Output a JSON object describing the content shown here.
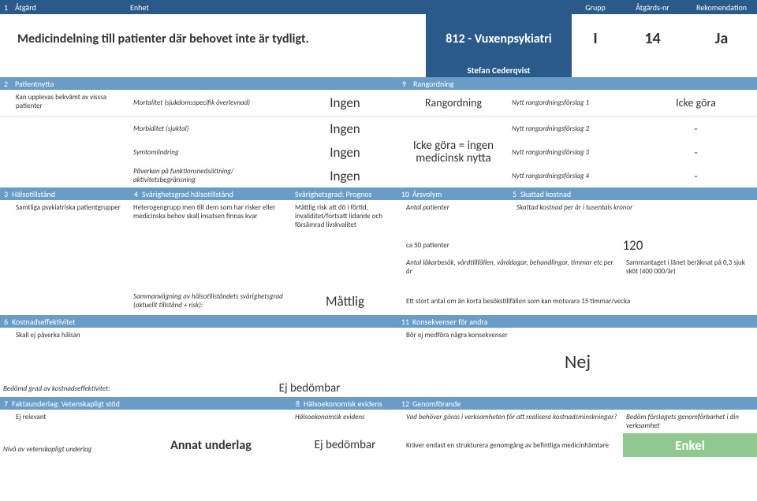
{
  "header": {
    "c1": "1",
    "c2": "Åtgärd",
    "c3": "Enhet",
    "c4": "Grupp",
    "c5": "Åtgärds-nr",
    "c6": "Rekomendation"
  },
  "title": {
    "main": "Medicindelning till patienter där behovet inte är tydligt.",
    "code": "812 - Vuxenpsykiatri",
    "grupp": "I",
    "nr": "14",
    "rec": "Ja",
    "author": "Stefan Cederqvist"
  },
  "sec2": {
    "num": "2",
    "label": "Patientnytta",
    "desc": "Kan upplevas bekvämt av visssa patienter",
    "r1lbl": "Mortalitet (sjukdomsspecifik överlevnad)",
    "r1val": "Ingen",
    "r2lbl": "Morbiditet (sjuktal)",
    "r2val": "Ingen",
    "r3lbl": "Symtomlindring",
    "r3val": "Ingen",
    "r4lbl": "Påverkan på funktionsnedsättning/ aktivitetsbegränsning",
    "r4val": "Ingen"
  },
  "sec9": {
    "num": "9",
    "label": "Rangordning",
    "title": "Rangordning",
    "r1lbl": "Nytt rangordningsförslag 1",
    "r1val": "Icke göra",
    "r2lbl": "Nytt rangordningsförslag 2",
    "r2val": "-",
    "r3lbl": "Nytt rangordningsförslag 3",
    "r3val": "-",
    "r4lbl": "Nytt rangordningsförslag 4",
    "r4val": "-",
    "big": "Icke göra = ingen medicinsk nytta"
  },
  "sec3": {
    "num": "3",
    "label": "Hälsotillstånd",
    "desc": "Samtliga psykiatriska patientgrupper"
  },
  "sec4": {
    "num": "4",
    "label": "Svårighetsgrad hälsotillstånd",
    "desc": "Heterogengrupp men till dem som har risker eller medicinska behov skall insatsen finnas kvar",
    "sumlbl": "Sammanvägning av hälsotillståndets svårighetsgrad (aktuellt tillstånd + risk):",
    "sumval": "Måttlig"
  },
  "secPrognos": {
    "label": "Svårighetsgrad: Prognos",
    "desc": "Måttlig risk att dö i förtid, invaliditet/fortsatt lidande och försämrad livskvalitet"
  },
  "sec10": {
    "num": "10",
    "label": "Årsvolym",
    "r1lbl": "Antal patienter",
    "r1val": "ca 50 patienter",
    "r2lbl": "Antal läkarbesök, vårdtillfällen, vårddagar, behandlingar, timmar etc per år",
    "r3val": "Ett stort antal om än korta besökstillfällen som kan motsvara 15 timmar/vecka"
  },
  "sec5": {
    "num": "5",
    "label": "Skattad kostnad",
    "r1lbl": "Skattad kostnad per år i tusentals kronor",
    "r1val": "120",
    "r2val": "Sammantaget i länet beräknat på 0,3 sjuk sköt (400 000/år)"
  },
  "sec6": {
    "num": "6",
    "label": "Kostnadseffektivitet",
    "desc": "Skall ej påverka hälsan",
    "sumlbl": "Bedömd grad av kostnadseffektivitet:",
    "sumval": "Ej bedömbar"
  },
  "sec11": {
    "num": "11",
    "label": "Konsekvenser för andra",
    "desc": "Bör ej medföra några konsekvenser",
    "big": "Nej"
  },
  "sec7": {
    "num": "7",
    "label": "Faktaunderlag: Vetenskapligt stöd",
    "desc": "Ej relevant",
    "sumlbl": "Nivå av vetenskapligt underlag",
    "sumval": "Annat underlag"
  },
  "sec8": {
    "num": "8",
    "label": "Hälsoekonomisk evidens",
    "desc": "Hälsoekonomsik evidens",
    "val": "Ej bedömbar"
  },
  "sec12": {
    "num": "12",
    "label": "Genomförande",
    "q1": "Vad behöver göras i verksamheten för att realisera kostnadsminskningar?",
    "a1": "Kräver endast en strukturera genomgång av befintliga medicinhämtare",
    "q2": "Bedöm förslagets genomförbarhet i din verksamhet",
    "val": "Enkel"
  }
}
